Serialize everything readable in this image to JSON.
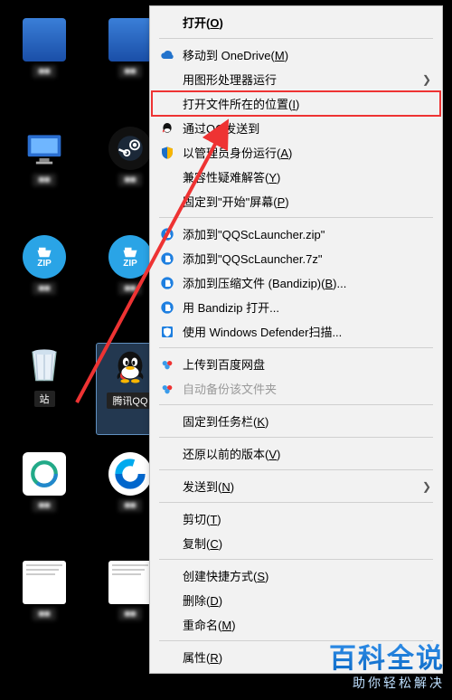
{
  "desktop": {
    "icons": [
      {
        "label": "■■",
        "kind": "blue"
      },
      {
        "label": "■■",
        "kind": "blue"
      },
      {
        "label": "■■",
        "kind": "monitor"
      },
      {
        "label": "■■",
        "kind": "steam"
      },
      {
        "label": "■■",
        "kind": "zip",
        "zip": "ZIP"
      },
      {
        "label": "■■",
        "kind": "zip",
        "zip": "ZIP"
      },
      {
        "label": "站",
        "kind": "bin"
      },
      {
        "label": "腾讯QQ",
        "kind": "qq",
        "selected": true
      },
      {
        "label": "■■",
        "kind": "ring"
      },
      {
        "label": "■■",
        "kind": "ring2"
      },
      {
        "label": "■■",
        "kind": "doc"
      },
      {
        "label": "■■",
        "kind": "doc"
      }
    ]
  },
  "menu": {
    "open": {
      "text": "打开",
      "accel": "O",
      "bold": true
    },
    "onedrive": {
      "text": "移动到 OneDrive",
      "accel": "M",
      "icon": "cloud"
    },
    "gpu": {
      "text": "用图形处理器运行",
      "sub": true
    },
    "openloc": {
      "text": "打开文件所在的位置",
      "accel": "I",
      "hl": true
    },
    "qqsend": {
      "text": "通过QQ发送到",
      "icon": "qq"
    },
    "admin": {
      "text": "以管理员身份运行",
      "accel": "A",
      "icon": "shield"
    },
    "compat": {
      "text": "兼容性疑难解答",
      "accel": "Y"
    },
    "pinstart": {
      "text": "固定到\"开始\"屏幕",
      "accel": "P"
    },
    "bzip1": {
      "text": "添加到\"QQScLauncher.zip\"",
      "icon": "bz"
    },
    "bzip2": {
      "text": "添加到\"QQScLauncher.7z\"",
      "icon": "bz"
    },
    "bzip3": {
      "text": "添加到压缩文件 (Bandizip)",
      "accel": "B",
      "icon": "bz",
      "ellipsis": true
    },
    "bzip4": {
      "text": "用 Bandizip 打开...",
      "icon": "bz"
    },
    "defender": {
      "text": "使用 Windows Defender扫描...",
      "icon": "def"
    },
    "baidu1": {
      "text": "上传到百度网盘",
      "icon": "baidu"
    },
    "baidu2": {
      "text": "自动备份该文件夹",
      "icon": "baidu",
      "disabled": true
    },
    "pintask": {
      "text": "固定到任务栏",
      "accel": "K"
    },
    "restore": {
      "text": "还原以前的版本",
      "accel": "V"
    },
    "sendto": {
      "text": "发送到",
      "accel": "N",
      "sub": true
    },
    "cut": {
      "text": "剪切",
      "accel": "T"
    },
    "copy": {
      "text": "复制",
      "accel": "C"
    },
    "shortcut": {
      "text": "创建快捷方式",
      "accel": "S"
    },
    "delete": {
      "text": "删除",
      "accel": "D"
    },
    "rename": {
      "text": "重命名",
      "accel": "M"
    },
    "props": {
      "text": "属性",
      "accel": "R"
    }
  },
  "watermark": {
    "big": "百科全说",
    "small": "助你轻松解决"
  }
}
